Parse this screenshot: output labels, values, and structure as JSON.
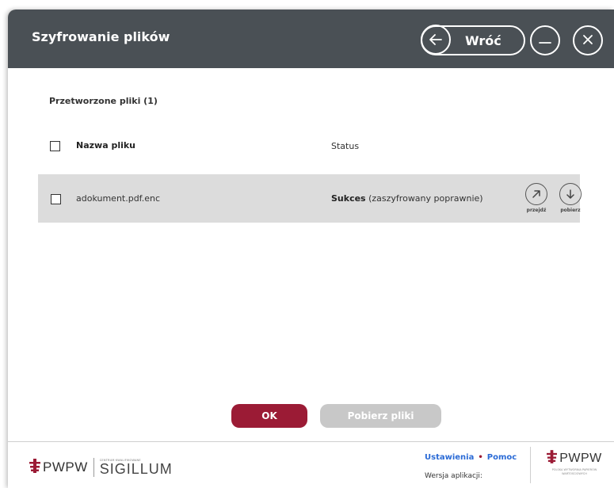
{
  "window": {
    "title": "Szyfrowanie plików",
    "back_label": "Wróć"
  },
  "list": {
    "section_title": "Przetworzone pliki (1)",
    "columns": {
      "name": "Nazwa pliku",
      "status": "Status"
    },
    "rows": [
      {
        "file_name": "adokument.pdf.enc",
        "status_bold": "Sukces",
        "status_detail": "(zaszyfrowany poprawnie)",
        "action_go": "przejdź",
        "action_download": "pobierz"
      }
    ]
  },
  "buttons": {
    "ok": "OK",
    "download_all": "Pobierz pliki"
  },
  "footer": {
    "brand_left": "PWPW",
    "brand_left_small": "CENTRUM KWALIFIKOWANE",
    "brand_product": "SIGILLUM",
    "link_settings": "Ustawienia",
    "link_help": "Pomoc",
    "version_label": "Wersja aplikacji:",
    "brand_right": "PWPW",
    "brand_right_sub": "POLSKA WYTWÓRNIA PAPIERÓW WARTOŚCIOWYCH"
  },
  "colors": {
    "header_bg": "#4a5055",
    "accent_red": "#9b1b35",
    "link_blue": "#2b6bd6",
    "row_bg": "#dcdcdc",
    "disabled_button": "#c8c8c8"
  },
  "icons": {
    "back": "arrow-left-icon",
    "minimize": "minimize-icon",
    "close": "close-icon",
    "go": "arrow-up-right-icon",
    "download": "arrow-down-icon",
    "logo": "pwpw-logo-icon"
  }
}
